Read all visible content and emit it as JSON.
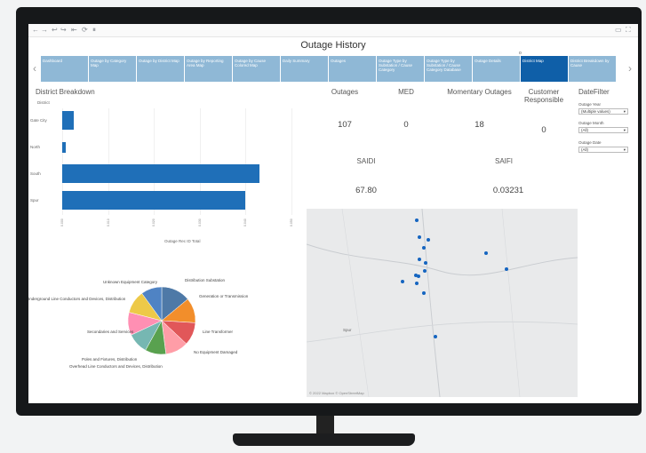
{
  "window": {
    "title": "Outage History"
  },
  "toolbar": {
    "back": "←",
    "forward": "→",
    "undo": "↩",
    "redo": "↪",
    "revert": "⇤",
    "refresh": "⟳",
    "pause": "⏸",
    "comment": "▭",
    "fullscreen": "⛶"
  },
  "tabs": [
    {
      "label": "Dashboard",
      "active": false
    },
    {
      "label": "Outage by Category Map",
      "active": false
    },
    {
      "label": "Outage by District Map",
      "active": false
    },
    {
      "label": "Outage by Reporting Area Map",
      "active": false
    },
    {
      "label": "Outage by Cause Colored Map",
      "active": false
    },
    {
      "label": "Daily Summary",
      "active": false
    },
    {
      "label": "Outages",
      "active": false
    },
    {
      "label": "Outage Type by Substation / Cause Category",
      "active": false
    },
    {
      "label": "Outage Type by Substation / Cause Category Database",
      "active": false
    },
    {
      "label": "Outage Details",
      "active": false
    },
    {
      "label": "District Map",
      "active": true
    },
    {
      "label": "District Breakdown by Cause",
      "active": false
    }
  ],
  "nav": {
    "prev": "‹",
    "next": "›",
    "indicator": "o"
  },
  "district_breakdown": {
    "title": "District Breakdown",
    "header": "District",
    "xlabel": "Outage Rec ID Total"
  },
  "chart_data": [
    {
      "type": "bar",
      "orientation": "horizontal",
      "title": "District Breakdown",
      "categories": [
        "Gate City",
        "North",
        "South",
        "Spur"
      ],
      "values": [
        0.0025,
        0.0007,
        0.043,
        0.04
      ],
      "xticks": [
        "0.000",
        "0.010",
        "0.020",
        "0.030",
        "0.040",
        "0.050"
      ],
      "xlim": [
        0,
        0.05
      ],
      "xlabel": "Outage Rec ID Total",
      "color": "#1f6fb8"
    },
    {
      "type": "pie",
      "categories": [
        "Distribution Substation",
        "Generation or Transmission",
        "Line Transformer",
        "No Equipment Damaged",
        "Overhead Line Conductors and Devices, Distribution",
        "Poles and Fixtures, Distribution",
        "Secondaries and Services",
        "Underground Line Conductors and Devices, Distribution",
        "Unknown Equipment Category"
      ],
      "values": [
        14,
        12,
        11,
        11,
        10,
        10,
        11,
        11,
        10
      ],
      "colors": [
        "#4e79a7",
        "#f28e2b",
        "#e15759",
        "#ff9da7",
        "#59a14f",
        "#76b7b2",
        "#ff8fb3",
        "#edc948",
        "#4f83c4"
      ]
    }
  ],
  "kpis": {
    "outages": {
      "label": "Outages",
      "value": "107"
    },
    "med": {
      "label": "MED",
      "value": "0"
    },
    "momentary": {
      "label": "Momentary Outages",
      "value": "18"
    },
    "customer": {
      "label": "Customer Responsible",
      "value": "0"
    },
    "saidi": {
      "label": "SAIDI",
      "value": "67.80"
    },
    "saifi": {
      "label": "SAIFI",
      "value": "0.03231"
    }
  },
  "filters": {
    "title": "DateFilter",
    "year": {
      "label": "Outage Year",
      "value": "(Multiple values)"
    },
    "month": {
      "label": "Outage Month",
      "value": "(All)"
    },
    "date": {
      "label": "Outage Date",
      "value": "(All)"
    }
  },
  "map": {
    "credit": "© 2022 Mapbox © OpenStreetMap",
    "town": "Spur"
  }
}
